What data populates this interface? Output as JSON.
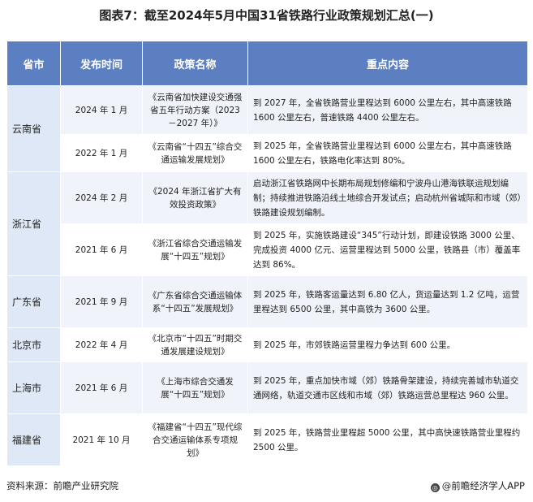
{
  "title": "图表7：截至2024年5月中国31省铁路行业政策规划汇总(一)",
  "headers": [
    "省市",
    "发布时间",
    "政策名称",
    "重点内容"
  ],
  "rows": [
    {
      "province": "云南省",
      "date": "2024 年 1 月",
      "name": "《云南省加快建设交通强省五年行动方案（2023－2027 年）》",
      "content": "到 2027 年，全省铁路营业里程达到 6000 公里左右，其中高速铁路 1600 公里左右，普速铁路 4400 公里左右。"
    },
    {
      "province": "",
      "date": "2022 年 1 月",
      "name": "《云南省“十四五”综合交通运输发展规划》",
      "content": "到 2025 年，全省铁路营业里程达到 6000 公里左右，其中高速铁路 1600 公里左右，铁路电化率达到 80%。"
    },
    {
      "province": "浙江省",
      "date": "2024 年 2 月",
      "name": "《2024 年浙江省扩大有效投资政策》",
      "content": "启动浙江省铁路网中长期布局规划修编和宁波舟山港海铁联运规划编制；持续推进铁路沿线土地综合开发试点；启动杭州省城际和市域（郊）铁路建设规划编制。"
    },
    {
      "province": "",
      "date": "2021 年 6 月",
      "name": "《浙江省综合交通运输发展“十四五”规划》",
      "content": "到 2025 年，实施铁路建设“345”行动计划，即建设铁路 3000 公里、完成投资 4000 亿元、运营里程达到 5000 公里，铁路县（市）覆盖率达到 86%。"
    },
    {
      "province": "广东省",
      "date": "2021 年 9 月",
      "name": "《广东省综合交通运输体系“十四五”发展规划》",
      "content": "到 2025 年，铁路客运量达到 6.80 亿人，货运量达到 1.2 亿吨，运营里程达到 6500 公里，其中高铁为 3600 公里。"
    },
    {
      "province": "北京市",
      "date": "2022 年 4 月",
      "name": "《北京市“十四五”时期交通发展建设规划》",
      "content": "到 2025 年，市郊铁路运营里程力争达到 600 公里。"
    },
    {
      "province": "上海市",
      "date": "2021 年 6 月",
      "name": "《上海市综合交通发展“十四五”规划》",
      "content": "到 2025 年，重点加快市域（郊）铁路骨架建设，持续完善城市轨道交通网络，轨道交通市区线和市域（郊）铁路运营总里程达 960 公里。"
    },
    {
      "province": "福建省",
      "date": "2021 年 10 月",
      "name": "《福建省“十四五”现代综合交通运输体系专项规划》",
      "content": "到 2025 年，铁路营业里程超 5000 公里，其中高快速铁路营业里程约 2500 公里。"
    }
  ],
  "footer": {
    "source": "资料来源：前瞻产业研究院",
    "brand": "@前瞻经济学人APP",
    "brand_icon": "logo-icon"
  }
}
